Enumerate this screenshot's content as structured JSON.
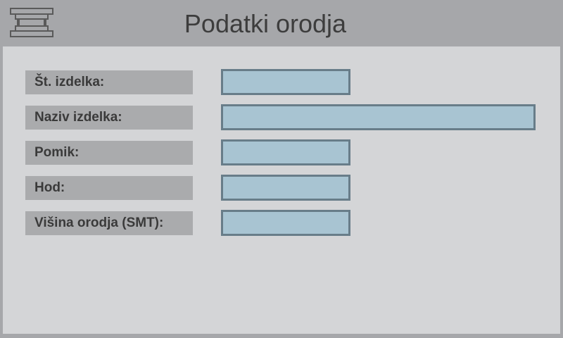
{
  "header": {
    "icon": "press-tool-icon",
    "title": "Podatki orodja"
  },
  "fields": [
    {
      "label": "Št. izdelka:",
      "value": ""
    },
    {
      "label": "Naziv izdelka:",
      "value": ""
    },
    {
      "label": "Pomik:",
      "value": ""
    },
    {
      "label": "Hod:",
      "value": ""
    },
    {
      "label": "Višina orodja (SMT):",
      "value": ""
    }
  ],
  "colors": {
    "background": "#a6a7aa",
    "panel": "#d4d5d7",
    "label_bg": "#aaabad",
    "field_bg": "#a8c4d2",
    "field_border": "#687d89"
  }
}
